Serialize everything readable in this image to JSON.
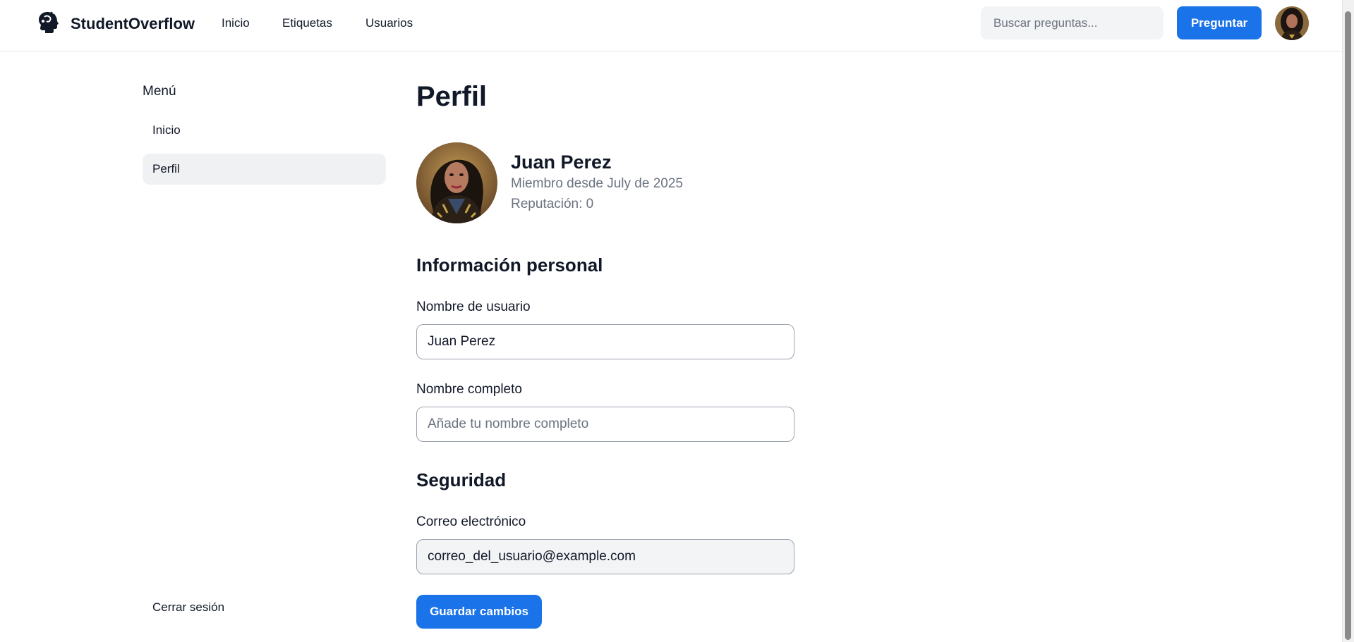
{
  "header": {
    "brand": "StudentOverflow",
    "logo_icon": "brain-head-icon",
    "nav": [
      "Inicio",
      "Etiquetas",
      "Usuarios"
    ],
    "search_placeholder": "Buscar preguntas...",
    "ask_label": "Preguntar"
  },
  "sidebar": {
    "heading": "Menú",
    "items": [
      {
        "label": "Inicio",
        "active": false
      },
      {
        "label": "Perfil",
        "active": true
      }
    ],
    "logout_label": "Cerrar sesión"
  },
  "main": {
    "title": "Perfil",
    "profile": {
      "name": "Juan Perez",
      "member_since": "Miembro desde July de 2025",
      "reputation": "Reputación: 0"
    },
    "personal_section": "Información personal",
    "username_label": "Nombre de usuario",
    "username_value": "Juan Perez",
    "fullname_label": "Nombre completo",
    "fullname_placeholder": "Añade tu nombre completo",
    "security_section": "Seguridad",
    "email_label": "Correo electrónico",
    "email_value": "correo_del_usuario@example.com",
    "save_label": "Guardar cambios"
  },
  "colors": {
    "accent": "#1a73e8",
    "active_bg": "#f0f1f3",
    "muted_text": "#6b7280"
  }
}
